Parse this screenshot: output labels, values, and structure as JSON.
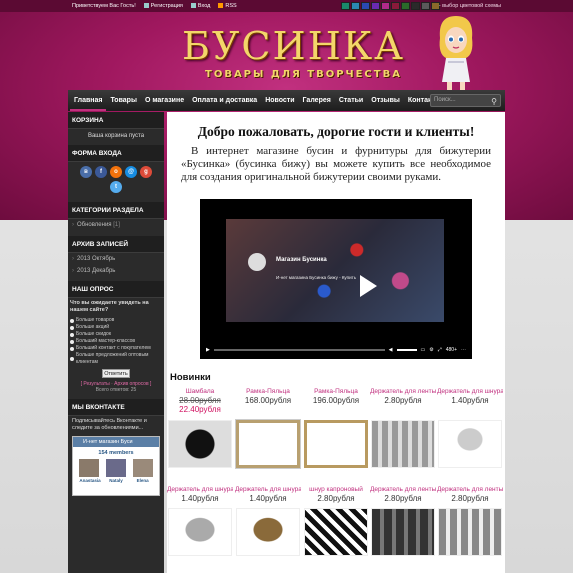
{
  "topbar": {
    "greeting": "Приветствуем Вас Гость!",
    "register": "Регистрация",
    "login": "Вход",
    "rss": "RSS",
    "scheme_label": "- выбор цветовой схемы",
    "swatch_colors": [
      "#1a8a6a",
      "#2a8ab0",
      "#2a4ab0",
      "#6a2ab0",
      "#b02a8a",
      "#8a1a3a",
      "#2a6a2a",
      "#2a2a2a",
      "#5a5a5a",
      "#8a6a2a"
    ]
  },
  "logo": {
    "title": "БУСИНКА",
    "tagline": "ТОВАРЫ ДЛЯ ТВОРЧЕСТВА"
  },
  "nav": {
    "items": [
      "Главная",
      "Товары",
      "О магазине",
      "Оплата и доставка",
      "Новости",
      "Галерея",
      "Статьи",
      "Отзывы",
      "Контакты"
    ],
    "search_placeholder": "Поиск..."
  },
  "sidebar": {
    "cart_title": "КОРЗИНА",
    "cart_empty": "Ваша корзина пуста",
    "login_title": "ФОРМА ВХОДА",
    "categories_title": "КАТЕГОРИИ РАЗДЕЛА",
    "categories": [
      {
        "label": "Обновления",
        "count": "[1]"
      }
    ],
    "archive_title": "АРХИВ ЗАПИСЕЙ",
    "archive": [
      "2013 Октябрь",
      "2013 Декабрь"
    ],
    "poll_title": "НАШ ОПРОС",
    "poll_question": "Что вы ожидаете увидеть на нашем сайте?",
    "poll_options": [
      "Больше товаров",
      "Больше акций",
      "Больше скидок",
      "Больший мастер-классов",
      "Больший контакт с покупателем",
      "Больше предложений оптовым клиентам"
    ],
    "vote_label": "Ответить",
    "poll_results": "[ Результаты · Архив опросов ]",
    "poll_total": "Всего ответов: 25",
    "vk_title": "МЫ ВКОНТАКТЕ",
    "vk_text": "Подписывайтесь Вконтакте и следите за обновлениями...",
    "vk_group": "И-нет магазин Буси",
    "vk_members": "154 members",
    "vk_users": [
      "Anastasia",
      "Nataly",
      "Elena"
    ]
  },
  "main": {
    "welcome": "Добро пожаловать, дорогие гости и клиенты!",
    "intro": "В интернет магазине бусин и фурнитуры для бижутерии «Бусинка» (бусинка бижу) вы можете купить все необходимое для создания оригинальной бижутерии своими руками.",
    "video_title": "Магазин Бусинка",
    "video_sub": "И-нет магазина Бусинка бижу - Купить",
    "video_time": "480+",
    "new_title": "Новинки",
    "products_row1": [
      {
        "name": "Шамбала",
        "old": "28.00рубля",
        "price": "22.40рубля",
        "sale": true
      },
      {
        "name": "Рамка-Пяльца",
        "price": "168.00рубля"
      },
      {
        "name": "Рамка-Пяльца",
        "price": "196.00рубля"
      },
      {
        "name": "Держатель для ленты",
        "price": "2.80рубля"
      },
      {
        "name": "Держатель для шнура",
        "price": "1.40рубля"
      }
    ],
    "products_row2": [
      {
        "name": "Держатель для шнура",
        "price": "1.40рубля"
      },
      {
        "name": "Держатель для шнура",
        "price": "1.40рубля"
      },
      {
        "name": "шнур капроновый",
        "price": "2.80рубля"
      },
      {
        "name": "Держатель для ленты",
        "price": "2.80рубля"
      },
      {
        "name": "Держатель для ленты",
        "price": "2.80рубля"
      }
    ]
  }
}
